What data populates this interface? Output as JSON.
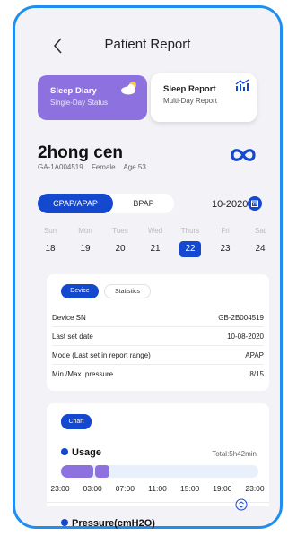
{
  "header": {
    "title": "Patient Report"
  },
  "report_cards": {
    "diary": {
      "title": "Sleep Diary",
      "subtitle": "Single-Day Status",
      "icon": "cloud-sun-icon"
    },
    "report": {
      "title": "Sleep Report",
      "subtitle": "Multi-Day Report",
      "icon": "trend-chart-icon"
    }
  },
  "patient": {
    "name": "2hong cen",
    "id": "GA-1A004519",
    "gender": "Female",
    "age": "Age 53"
  },
  "mode_tabs": {
    "active": "CPAP/APAP",
    "other": "BPAP"
  },
  "month": "10-2020",
  "week": [
    {
      "name": "Sun",
      "date": "18"
    },
    {
      "name": "Mon",
      "date": "19"
    },
    {
      "name": "Tues",
      "date": "20"
    },
    {
      "name": "Wed",
      "date": "21"
    },
    {
      "name": "Thurs",
      "date": "22"
    },
    {
      "name": "Fri",
      "date": "23"
    },
    {
      "name": "Sat",
      "date": "24"
    }
  ],
  "selected_day": "22",
  "device_panel": {
    "tab_device": "Device",
    "tab_statistics": "Statistics",
    "rows": [
      {
        "label": "Device SN",
        "value": "GB-2B004519"
      },
      {
        "label": "Last set date",
        "value": "10-08-2020"
      },
      {
        "label": "Mode (Last set in report range)",
        "value": "APAP"
      },
      {
        "label": "Min./Max. pressure",
        "value": "8/15"
      }
    ]
  },
  "chart_panel": {
    "button": "Chart",
    "usage_title": "Usage",
    "usage_total": "Total:5h42min",
    "hours": [
      "23:00",
      "03:00",
      "07:00",
      "11:00",
      "15:00",
      "19:00",
      "23:00"
    ],
    "pressure_title": "Pressure(cmH2O)"
  },
  "colors": {
    "accent": "#1448cf",
    "purple": "#8d72df",
    "frame": "#1f8ef0"
  }
}
